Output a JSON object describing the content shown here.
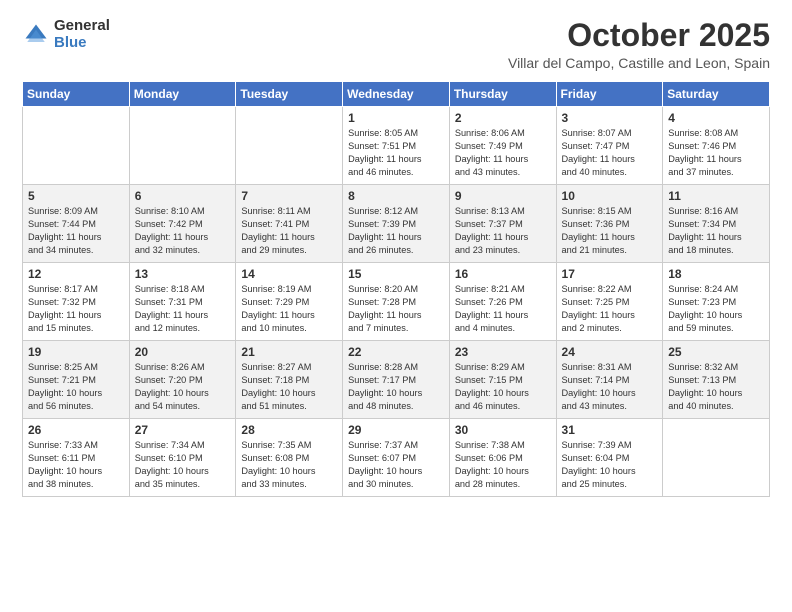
{
  "logo": {
    "general": "General",
    "blue": "Blue"
  },
  "header": {
    "month": "October 2025",
    "location": "Villar del Campo, Castille and Leon, Spain"
  },
  "weekdays": [
    "Sunday",
    "Monday",
    "Tuesday",
    "Wednesday",
    "Thursday",
    "Friday",
    "Saturday"
  ],
  "weeks": [
    [
      {
        "day": "",
        "info": ""
      },
      {
        "day": "",
        "info": ""
      },
      {
        "day": "",
        "info": ""
      },
      {
        "day": "1",
        "info": "Sunrise: 8:05 AM\nSunset: 7:51 PM\nDaylight: 11 hours\nand 46 minutes."
      },
      {
        "day": "2",
        "info": "Sunrise: 8:06 AM\nSunset: 7:49 PM\nDaylight: 11 hours\nand 43 minutes."
      },
      {
        "day": "3",
        "info": "Sunrise: 8:07 AM\nSunset: 7:47 PM\nDaylight: 11 hours\nand 40 minutes."
      },
      {
        "day": "4",
        "info": "Sunrise: 8:08 AM\nSunset: 7:46 PM\nDaylight: 11 hours\nand 37 minutes."
      }
    ],
    [
      {
        "day": "5",
        "info": "Sunrise: 8:09 AM\nSunset: 7:44 PM\nDaylight: 11 hours\nand 34 minutes."
      },
      {
        "day": "6",
        "info": "Sunrise: 8:10 AM\nSunset: 7:42 PM\nDaylight: 11 hours\nand 32 minutes."
      },
      {
        "day": "7",
        "info": "Sunrise: 8:11 AM\nSunset: 7:41 PM\nDaylight: 11 hours\nand 29 minutes."
      },
      {
        "day": "8",
        "info": "Sunrise: 8:12 AM\nSunset: 7:39 PM\nDaylight: 11 hours\nand 26 minutes."
      },
      {
        "day": "9",
        "info": "Sunrise: 8:13 AM\nSunset: 7:37 PM\nDaylight: 11 hours\nand 23 minutes."
      },
      {
        "day": "10",
        "info": "Sunrise: 8:15 AM\nSunset: 7:36 PM\nDaylight: 11 hours\nand 21 minutes."
      },
      {
        "day": "11",
        "info": "Sunrise: 8:16 AM\nSunset: 7:34 PM\nDaylight: 11 hours\nand 18 minutes."
      }
    ],
    [
      {
        "day": "12",
        "info": "Sunrise: 8:17 AM\nSunset: 7:32 PM\nDaylight: 11 hours\nand 15 minutes."
      },
      {
        "day": "13",
        "info": "Sunrise: 8:18 AM\nSunset: 7:31 PM\nDaylight: 11 hours\nand 12 minutes."
      },
      {
        "day": "14",
        "info": "Sunrise: 8:19 AM\nSunset: 7:29 PM\nDaylight: 11 hours\nand 10 minutes."
      },
      {
        "day": "15",
        "info": "Sunrise: 8:20 AM\nSunset: 7:28 PM\nDaylight: 11 hours\nand 7 minutes."
      },
      {
        "day": "16",
        "info": "Sunrise: 8:21 AM\nSunset: 7:26 PM\nDaylight: 11 hours\nand 4 minutes."
      },
      {
        "day": "17",
        "info": "Sunrise: 8:22 AM\nSunset: 7:25 PM\nDaylight: 11 hours\nand 2 minutes."
      },
      {
        "day": "18",
        "info": "Sunrise: 8:24 AM\nSunset: 7:23 PM\nDaylight: 10 hours\nand 59 minutes."
      }
    ],
    [
      {
        "day": "19",
        "info": "Sunrise: 8:25 AM\nSunset: 7:21 PM\nDaylight: 10 hours\nand 56 minutes."
      },
      {
        "day": "20",
        "info": "Sunrise: 8:26 AM\nSunset: 7:20 PM\nDaylight: 10 hours\nand 54 minutes."
      },
      {
        "day": "21",
        "info": "Sunrise: 8:27 AM\nSunset: 7:18 PM\nDaylight: 10 hours\nand 51 minutes."
      },
      {
        "day": "22",
        "info": "Sunrise: 8:28 AM\nSunset: 7:17 PM\nDaylight: 10 hours\nand 48 minutes."
      },
      {
        "day": "23",
        "info": "Sunrise: 8:29 AM\nSunset: 7:15 PM\nDaylight: 10 hours\nand 46 minutes."
      },
      {
        "day": "24",
        "info": "Sunrise: 8:31 AM\nSunset: 7:14 PM\nDaylight: 10 hours\nand 43 minutes."
      },
      {
        "day": "25",
        "info": "Sunrise: 8:32 AM\nSunset: 7:13 PM\nDaylight: 10 hours\nand 40 minutes."
      }
    ],
    [
      {
        "day": "26",
        "info": "Sunrise: 7:33 AM\nSunset: 6:11 PM\nDaylight: 10 hours\nand 38 minutes."
      },
      {
        "day": "27",
        "info": "Sunrise: 7:34 AM\nSunset: 6:10 PM\nDaylight: 10 hours\nand 35 minutes."
      },
      {
        "day": "28",
        "info": "Sunrise: 7:35 AM\nSunset: 6:08 PM\nDaylight: 10 hours\nand 33 minutes."
      },
      {
        "day": "29",
        "info": "Sunrise: 7:37 AM\nSunset: 6:07 PM\nDaylight: 10 hours\nand 30 minutes."
      },
      {
        "day": "30",
        "info": "Sunrise: 7:38 AM\nSunset: 6:06 PM\nDaylight: 10 hours\nand 28 minutes."
      },
      {
        "day": "31",
        "info": "Sunrise: 7:39 AM\nSunset: 6:04 PM\nDaylight: 10 hours\nand 25 minutes."
      },
      {
        "day": "",
        "info": ""
      }
    ]
  ]
}
